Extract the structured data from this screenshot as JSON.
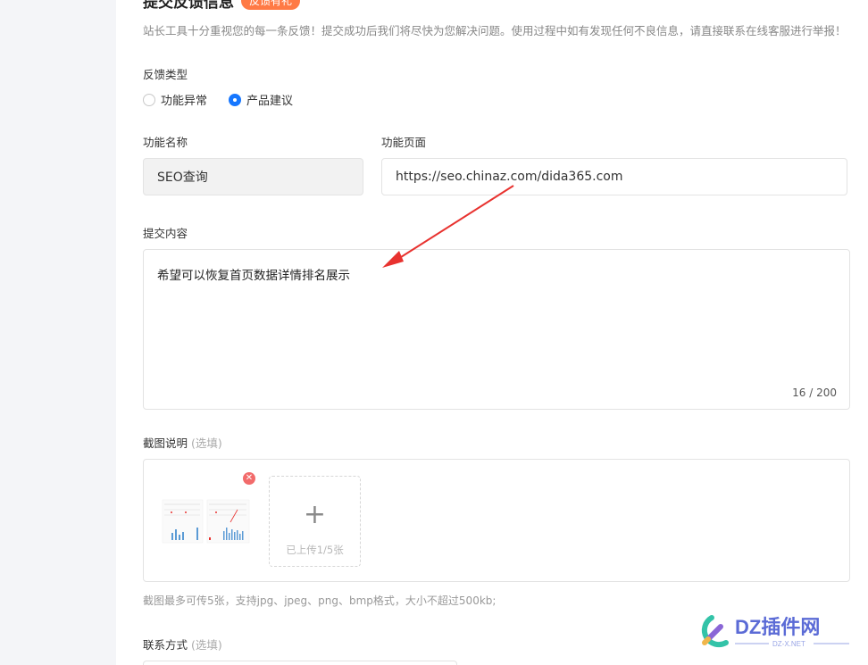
{
  "form": {
    "title": "提交反馈信息",
    "badge": "反馈有礼",
    "notice": "站长工具十分重视您的每一条反馈！提交成功后我们将尽快为您解决问题。使用过程中如有发现任何不良信息，请直接联系在线客服进行举报！",
    "type_label": "反馈类型",
    "type_options": [
      {
        "label": "功能异常",
        "selected": false
      },
      {
        "label": "产品建议",
        "selected": true
      }
    ],
    "func_name_label": "功能名称",
    "func_name_value": "SEO查询",
    "func_page_label": "功能页面",
    "func_page_value": "https://seo.chinaz.com/dida365.com",
    "content_label": "提交内容",
    "content_value": "希望可以恢复首页数据详情排名展示",
    "content_counter": "16 / 200",
    "screenshot_label": "截图说明",
    "optional_text": "(选填)",
    "upload_text": "已上传1/5张",
    "upload_plus": "+",
    "upload_hint": "截图最多可传5张，支持jpg、jpeg、png、bmp格式，大小不超过500kb;",
    "contact_label": "联系方式"
  },
  "watermark": {
    "brand": "DZ插件网",
    "domain": "DZ-X.NET"
  },
  "colors": {
    "accent": "#1677ff",
    "badge": "#ff7a45",
    "arrow": "#e8322f",
    "delete": "#f26b6b"
  }
}
